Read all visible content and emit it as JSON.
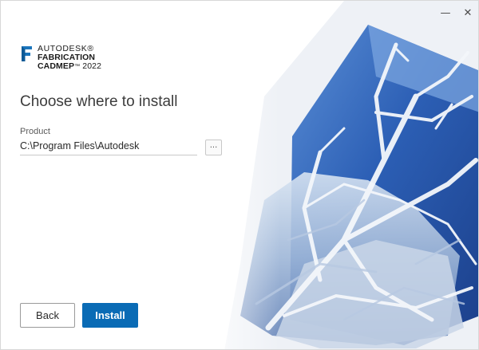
{
  "window": {
    "minimize_glyph": "—",
    "close_glyph": "✕"
  },
  "logo": {
    "line1": "AUTODESK®",
    "line2": "FABRICATION",
    "line3_name": "CADMEP",
    "line3_tm": "™",
    "line3_year": "2022",
    "brand_color": "#1b75bc"
  },
  "main": {
    "heading": "Choose where to install",
    "product_label": "Product",
    "product_path": "C:\\Program Files\\Autodesk",
    "browse_label": "..."
  },
  "footer": {
    "back_label": "Back",
    "install_label": "Install"
  },
  "colors": {
    "primary_button": "#0a6bb5",
    "art_blue": "#2d5fb0"
  }
}
